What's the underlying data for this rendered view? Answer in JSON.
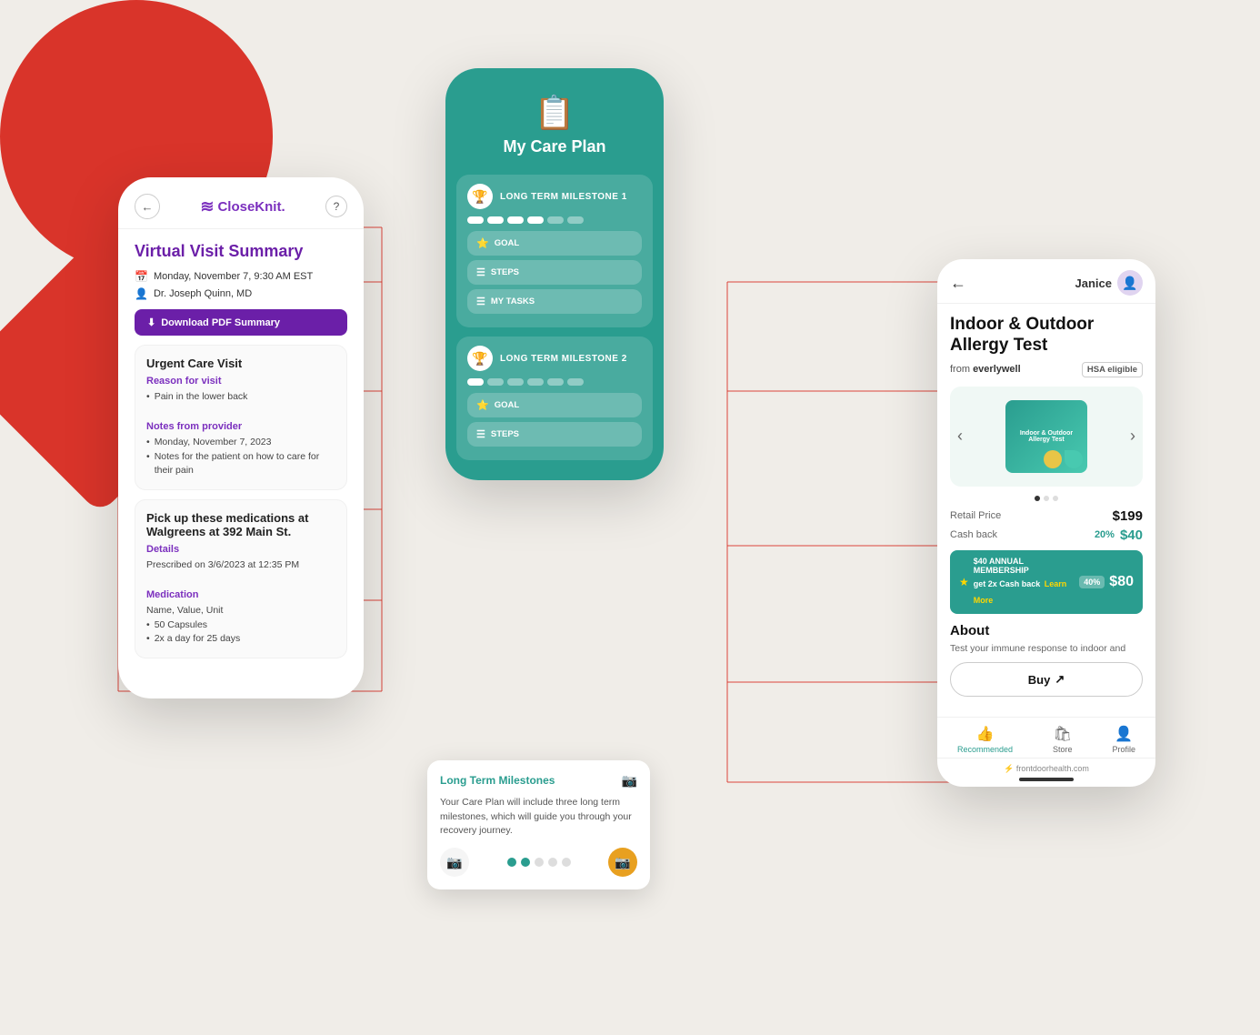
{
  "background": {
    "color": "#f0ede8"
  },
  "left_phone": {
    "header": {
      "back_label": "←",
      "logo_text": "CloseKnit.",
      "logo_icon": "≋",
      "help_icon": "?"
    },
    "title": "Virtual Visit Summary",
    "date": "Monday, November 7, 9:30 AM EST",
    "doctor": "Dr. Joseph Quinn, MD",
    "download_label": "Download PDF Summary",
    "urgent_care": {
      "section_title": "Urgent Care Visit",
      "reason_title": "Reason for visit",
      "reason_item": "Pain in the lower back",
      "notes_title": "Notes from provider",
      "note_1": "Monday, November 7, 2023",
      "note_2": "Notes for the patient on how to care for their pain"
    },
    "medications": {
      "section_title": "Pick up these medications at Walgreens at 392 Main St.",
      "details_title": "Details",
      "details_text": "Prescribed on 3/6/2023 at 12:35 PM",
      "medication_title": "Medication",
      "med_name": "Name, Value, Unit",
      "med_qty": "50 Capsules",
      "med_freq": "2x a day for 25 days"
    }
  },
  "middle_phone": {
    "icon": "📋",
    "title": "My Care Plan",
    "milestone_1": {
      "label": "LONG TERM MILESTONE 1",
      "dots": [
        true,
        true,
        true,
        true,
        false,
        false
      ],
      "goal_label": "GOAL",
      "steps_label": "STEPS",
      "tasks_label": "MY TASKS"
    },
    "milestone_2": {
      "label": "LONG TERM MILESTONE 2",
      "dots": [
        true,
        false,
        false,
        false,
        false,
        false
      ],
      "goal_label": "GOAL",
      "steps_label": "STEPS"
    },
    "tooltip": {
      "title": "Long Term Milestones",
      "text": "Your Care Plan will include three long term milestones, which will guide you through your recovery journey.",
      "progress": [
        true,
        true,
        false,
        false,
        false
      ]
    }
  },
  "right_phone": {
    "back_label": "←",
    "user_name": "Janice",
    "title": "Indoor & Outdoor Allergy Test",
    "from_label": "from",
    "brand": "everlywell",
    "hsa_label": "HSA eligible",
    "product_label": "Indoor & Outdoor\nAllergy Test",
    "retail_price_label": "Retail Price",
    "retail_price": "$199",
    "cashback_label": "Cash back",
    "cashback_pct": "20%",
    "cashback_amt": "$40",
    "membership_text": "$40 ANNUAL MEMBERSHIP",
    "membership_sub": "get 2x Cash back",
    "learn_more": "Learn More",
    "membership_badge": "40%",
    "membership_price": "$80",
    "about_title": "About",
    "about_text": "Test your immune response to indoor and",
    "buy_label": "Buy",
    "nav_items": [
      "Recommended",
      "Store",
      "Profile"
    ],
    "footer_url": "frontdoorhealth.com"
  }
}
